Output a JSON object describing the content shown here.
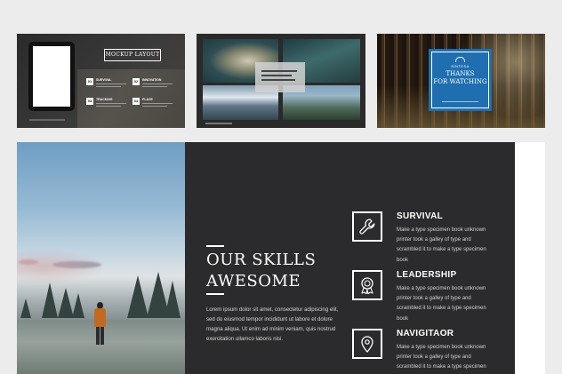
{
  "thumbnails": {
    "mockup": {
      "badge": "MOCKUP LAYOUT",
      "features": [
        {
          "num": "01",
          "label": "SURVIVAL"
        },
        {
          "num": "02",
          "label": "INNOVATION"
        },
        {
          "num": "03",
          "label": "TRACKING"
        },
        {
          "num": "04",
          "label": "PLACE"
        }
      ]
    },
    "thanks": {
      "brand": "SINTESA",
      "title_line1": "THANKS",
      "title_line2": "FOR WATCHING"
    }
  },
  "slide": {
    "heading_line1": "OUR SKILLS",
    "heading_line2": "AWESOME",
    "paragraph": "Lorem ipsum dolor sit amet, consectetur adipiscing elit, sed do eiusmod tempor incididunt ut labore et dolore magna aliqua. Ut enim ad minim veniam, quis nostrud exercitation ullamco laboris nisi.",
    "skills": [
      {
        "title": "SURVIVAL",
        "icon": "wrench-icon",
        "desc": "Make a type specimen book unknown printer took a galley of type and scrambled it to make a type specimen book"
      },
      {
        "title": "LEADERSHIP",
        "icon": "award-icon",
        "desc": "Make a type specimen book unknown printer took a galley of type and scrambled it to make a type specimen book"
      },
      {
        "title": "NAVIGITAOR",
        "icon": "map-pin-icon",
        "desc": "Make a type specimen book unknown printer took a galley of type and scrambled it to make a type specimen book"
      }
    ]
  },
  "colors": {
    "background": "#ececec",
    "dark_panel": "#2b2b2d",
    "accent_blue": "#1f6fb0"
  }
}
